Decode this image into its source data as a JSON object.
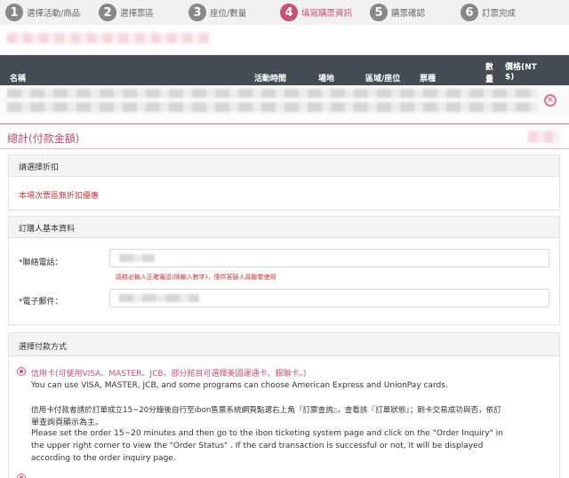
{
  "steps": [
    {
      "num": "1",
      "label": "選擇活動/商品"
    },
    {
      "num": "2",
      "label": "選擇票區"
    },
    {
      "num": "3",
      "label": "座位/數量"
    },
    {
      "num": "4",
      "label": "填寫購票資訊"
    },
    {
      "num": "5",
      "label": "購票確認"
    },
    {
      "num": "6",
      "label": "訂票完成"
    }
  ],
  "table": {
    "headers": {
      "name": "名稱",
      "time": "活動時間",
      "venue": "場地",
      "area": "區域/座位",
      "ticket_type": "票種",
      "qty_1": "數",
      "qty_2": "量",
      "price_1": "價格(NT",
      "price_2": "$)"
    }
  },
  "total": {
    "title": "總計(付款金額)"
  },
  "discount": {
    "title": "請選擇折扣",
    "message": "本場次票區無折扣優惠"
  },
  "buyer": {
    "title": "訂購人基本資料",
    "phone_label": "*聯絡電話：",
    "phone_hint": "請務必輸入正確電話(限輸入數字)，僅供客服人員聯繫使用",
    "email_label": "*電子郵件："
  },
  "payment": {
    "title": "選擇付款方式",
    "credit_label": "信用卡(可使用VISA、MASTER、JCB，部分館目可選擇美國運通卡、銀聯卡。)",
    "credit_en": "You can use VISA, MASTER, JCB, and some programs can choose American Express and UnionPay cards.",
    "notice_zh_1": "信用卡付款者請於訂單成立15~20分鐘後自行至ibon售票系統網頁點選右上角『訂票查詢』，查看該『訂單狀態』；刷卡交易成功與否，依訂",
    "notice_zh_2": "單查詢頁顯示為主。",
    "notice_en_1": "Please set the order 15~20 minutes and then go to the ibon ticketing system page and click on the  \"Order Inquiry\"  in",
    "notice_en_2": "the upper right corner to view the  \"Order Status\" . If the card transaction is successful or not, it will be displayed",
    "notice_en_3": "according to the order inquiry page."
  }
}
